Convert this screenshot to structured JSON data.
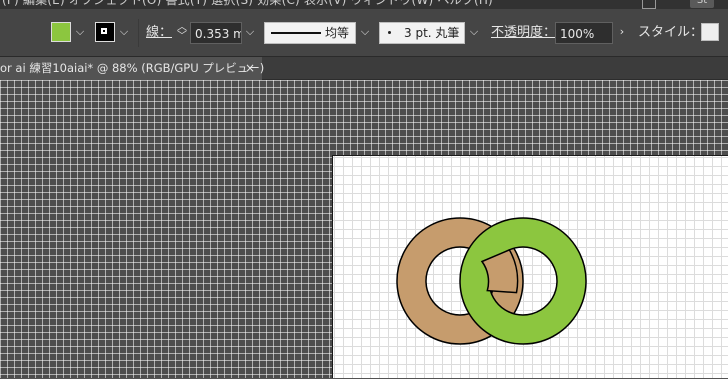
{
  "menubar": {
    "items_text": "(F)   編集(E)   オブジェクト(O)   書式(T)   選択(S)   効果(C)   表示(V)   ウィンドウ(W)   ヘルプ(H)",
    "st_label": "St"
  },
  "control": {
    "stroke_label": "線：",
    "stroke_weight": "0.353 m",
    "stroke_profile": "均等",
    "brush": "3 pt. 丸筆",
    "opacity_label": "不透明度：",
    "opacity_value": "100%",
    "style_label": "スタイル："
  },
  "document_tab": {
    "title": "or ai 練習10aiai* @ 88% (RGB/GPU プレビュー)",
    "close": "×"
  },
  "colors": {
    "fill": "#8cc63f",
    "stroke": "#000000",
    "ring_back": "#c69c6d",
    "ring_front": "#8cc63f"
  },
  "icons": [
    "chevron-down-icon",
    "stepper-icon",
    "chevron-right-icon",
    "close-icon",
    "stroke-line-icon",
    "dot-icon"
  ]
}
